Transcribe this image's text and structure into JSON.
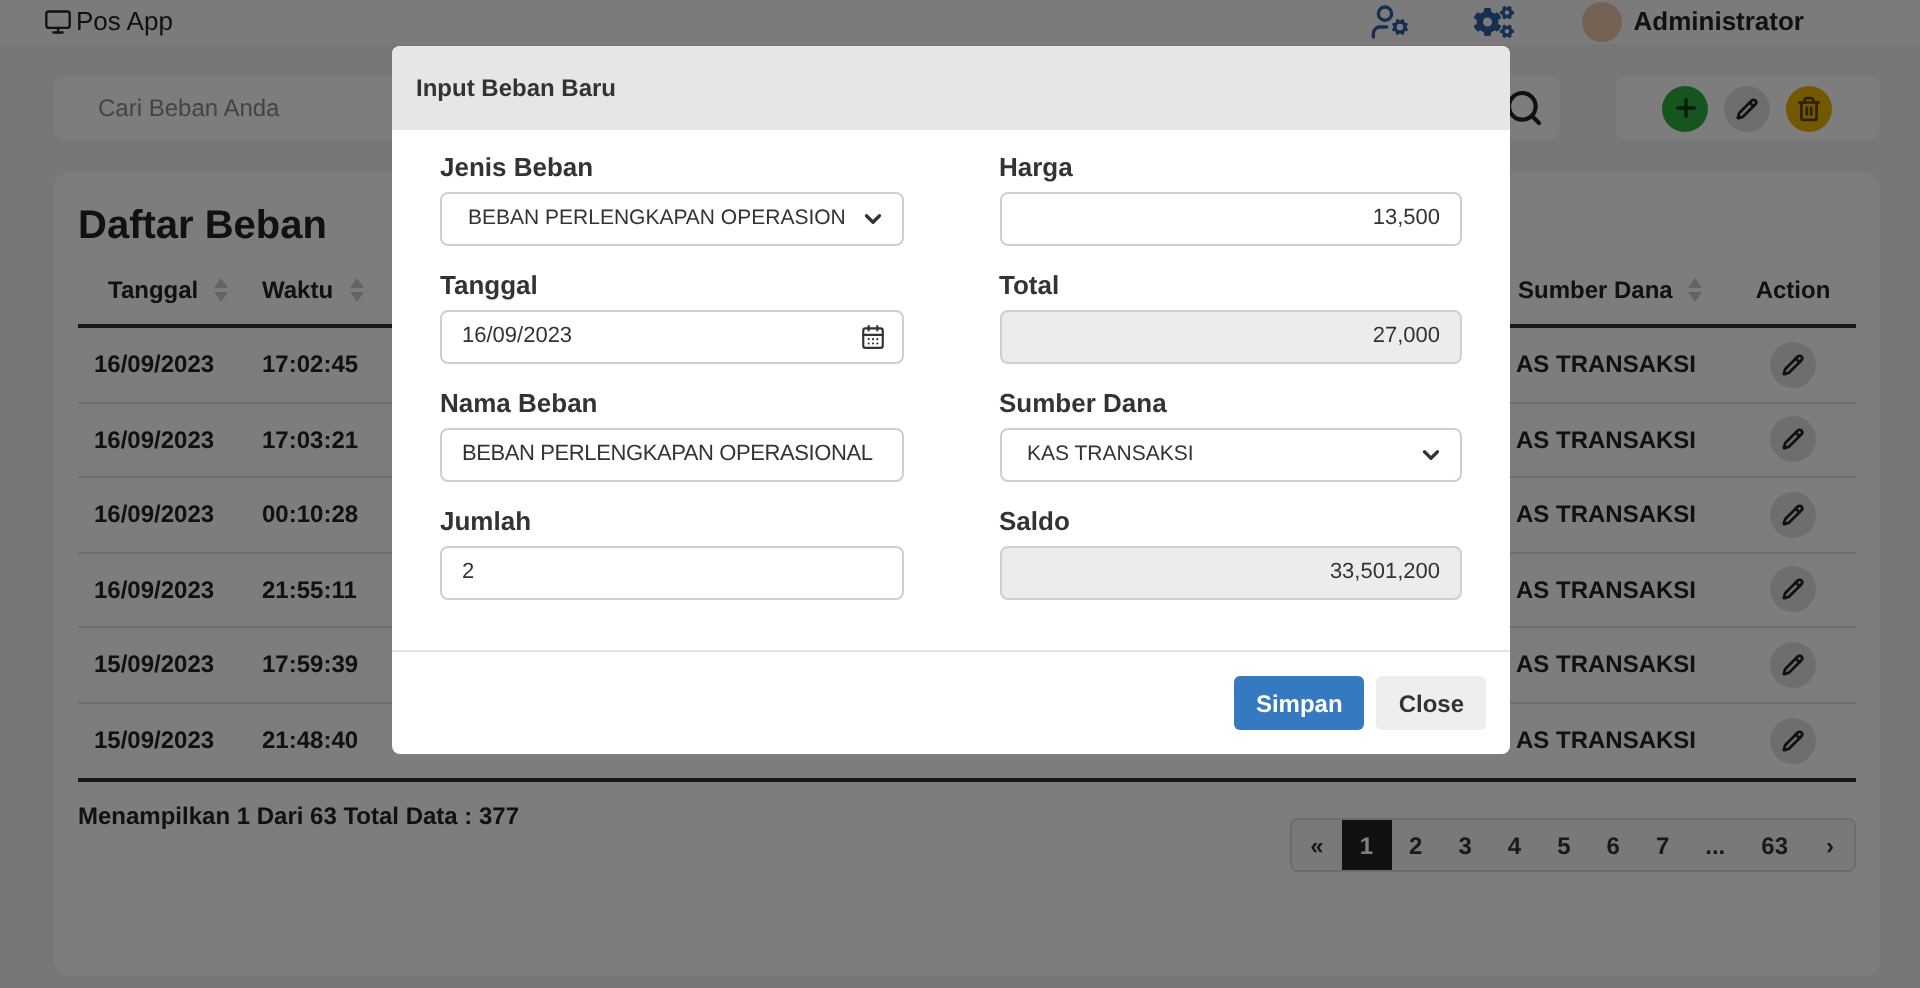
{
  "app": {
    "title": "Pos App",
    "user": "Administrator"
  },
  "search": {
    "placeholder": "Cari Beban Anda"
  },
  "list": {
    "title": "Daftar Beban",
    "columns": [
      {
        "label": "Tanggal",
        "sortable": true
      },
      {
        "label": "Waktu",
        "sortable": true
      },
      {
        "label": "Sumber Dana",
        "sortable": true
      },
      {
        "label": "Action",
        "sortable": false
      }
    ],
    "rows": [
      {
        "date": "16/09/2023",
        "time": "17:02:45",
        "source": "AS TRANSAKSI"
      },
      {
        "date": "16/09/2023",
        "time": "17:03:21",
        "source": "AS TRANSAKSI"
      },
      {
        "date": "16/09/2023",
        "time": "00:10:28",
        "source": "AS TRANSAKSI"
      },
      {
        "date": "16/09/2023",
        "time": "21:55:11",
        "source": "AS TRANSAKSI"
      },
      {
        "date": "15/09/2023",
        "time": "17:59:39",
        "source": "AS TRANSAKSI"
      },
      {
        "date": "15/09/2023",
        "time": "21:48:40",
        "source": "AS TRANSAKSI"
      }
    ],
    "summary": "Menampilkan 1 Dari 63 Total Data : 377",
    "pagination": [
      {
        "label": "«",
        "selected": false
      },
      {
        "label": "1",
        "selected": true
      },
      {
        "label": "2",
        "selected": false
      },
      {
        "label": "3",
        "selected": false
      },
      {
        "label": "4",
        "selected": false
      },
      {
        "label": "5",
        "selected": false
      },
      {
        "label": "6",
        "selected": false
      },
      {
        "label": "7",
        "selected": false
      },
      {
        "label": "...",
        "selected": false
      },
      {
        "label": "63",
        "selected": false
      },
      {
        "label": "›",
        "selected": false
      }
    ]
  },
  "modal": {
    "title": "Input Beban Baru",
    "fields": [
      {
        "label": "Jenis Beban",
        "kind": "select",
        "value": "BEBAN PERLENGKAPAN OPERASION"
      },
      {
        "label": "Harga",
        "kind": "number",
        "value": "13,500"
      },
      {
        "label": "Tanggal",
        "kind": "date",
        "value": "16/09/2023"
      },
      {
        "label": "Total",
        "kind": "readonly",
        "value": "27,000"
      },
      {
        "label": "Nama Beban",
        "kind": "text",
        "value": "BEBAN PERLENGKAPAN OPERASIONAL"
      },
      {
        "label": "Sumber Dana",
        "kind": "select",
        "value": "KAS TRANSAKSI"
      },
      {
        "label": "Jumlah",
        "kind": "text",
        "value": "2"
      },
      {
        "label": "Saldo",
        "kind": "readonly",
        "value": "33,501,200"
      }
    ],
    "buttons": [
      {
        "label": "Simpan",
        "kind": "primary"
      },
      {
        "label": "Close",
        "kind": "secondary"
      }
    ]
  }
}
